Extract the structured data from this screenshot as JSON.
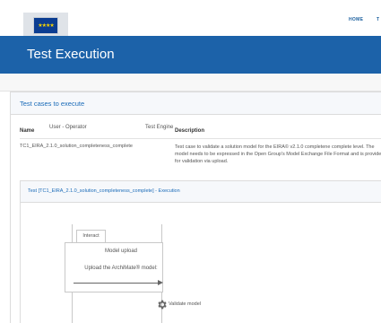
{
  "header": {
    "nav": [
      "HOME",
      "T"
    ]
  },
  "banner": {
    "title": "Test Execution"
  },
  "panel": {
    "title": "Test cases to execute",
    "columns": [
      "Name",
      "Description"
    ],
    "rows": [
      {
        "name": "TC1_EIRA_2.1.0_solution_completeness_complete",
        "description": "Test case to validate a solution model for the EIRA© v2.1.0 completene complete level. The model needs to be expressed in the Open Group's Model Exchange File Format and is provided for validation via upload."
      }
    ]
  },
  "execution": {
    "title": "Test [TC1_EIRA_2.1.0_solution_completeness_complete] - Execution",
    "actors": [
      "User - Operator",
      "Test Engine"
    ],
    "fragment_label": "Interact",
    "messages": [
      "Model upload",
      "Upload the ArchiMate® model:"
    ],
    "step_label": "Validate model"
  },
  "icons": {
    "logo": "eu-flag-logo",
    "step": "gear-icon"
  },
  "colors": {
    "banner": "#1c62a9",
    "link": "#1a6bb8"
  }
}
